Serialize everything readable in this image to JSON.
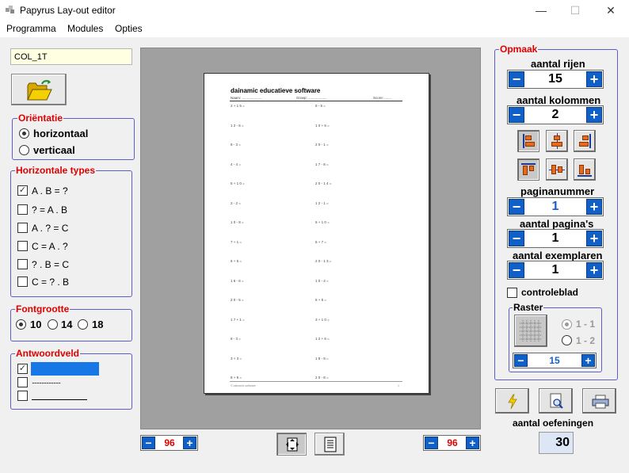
{
  "window": {
    "title": "Papyrus Lay-out editor",
    "minimize": "—",
    "maximize": "☐",
    "close": "✕"
  },
  "menu": [
    "Programma",
    "Modules",
    "Opties"
  ],
  "name_value": "COL_1T",
  "orientatie": {
    "legend": "Oriëntatie",
    "options": [
      "horizontaal",
      "verticaal"
    ],
    "selected": 0
  },
  "types": {
    "legend": "Horizontale types",
    "items": [
      {
        "label": "A . B = ?",
        "checked": true
      },
      {
        "label": "? = A . B",
        "checked": false
      },
      {
        "label": "A . ? = C",
        "checked": false
      },
      {
        "label": "C = A . ?",
        "checked": false
      },
      {
        "label": "? . B = C",
        "checked": false
      },
      {
        "label": "C = ? . B",
        "checked": false
      }
    ]
  },
  "fontgrootte": {
    "legend": "Fontgrootte",
    "options": [
      "10",
      "14",
      "18"
    ],
    "selected": 0
  },
  "antwoordveld": {
    "legend": "Antwoordveld",
    "dots": "........................"
  },
  "page": {
    "title": "dainamic educatieve software",
    "naam": "Naam: ....................",
    "groep": "Groep: ...................",
    "score": "Score: .......",
    "left_col": [
      "2 + 1 5 =",
      "1 2 - 6 =",
      "8 - 3 =",
      "4 - 4 =",
      "5 + 1 0 =",
      "2 - 2 =",
      "1 0 - 8 =",
      "7 + 1 =",
      "6 + 5 =",
      "1 6 - 6 =",
      "2 0 - 5 =",
      "1 7 + 1 =",
      "8 - 3 =",
      "3 + 3 =",
      "8 + 9 ="
    ],
    "right_col": [
      "5 - 5 =",
      "1 0 + 6 =",
      "2 0 - 1 =",
      "1 7 - 8 =",
      "2 0 - 1 4 =",
      "1 2 - 1 =",
      "5 + 1 0 =",
      "5 + 7 =",
      "2 0 - 1 3 =",
      "1 0 - 4 =",
      "6 + 5 =",
      "3 + 1 0 =",
      "1 2 + 6 =",
      "1 8 - 9 =",
      "2 0 - 8 ="
    ],
    "footer_left": "© dainamic software",
    "footer_right": "1"
  },
  "zoom_left": "96",
  "zoom_right": "96",
  "opmaak": {
    "legend": "Opmaak",
    "rijen_label": "aantal rijen",
    "rijen": "15",
    "kolommen_label": "aantal kolommen",
    "kolommen": "2",
    "paginanummer_label": "paginanummer",
    "paginanummer": "1",
    "paginas_label": "aantal pagina's",
    "paginas": "1",
    "exemplaren_label": "aantal exemplaren",
    "exemplaren": "1",
    "controleblad": "controleblad",
    "raster": {
      "legend": "Raster",
      "options": [
        "1 - 1",
        "1 - 2"
      ],
      "selected": 0,
      "value": "15"
    }
  },
  "oefeningen_label": "aantal oefeningen",
  "oefeningen": "30",
  "accent": "#1060c8",
  "legend_color": "#e00000"
}
